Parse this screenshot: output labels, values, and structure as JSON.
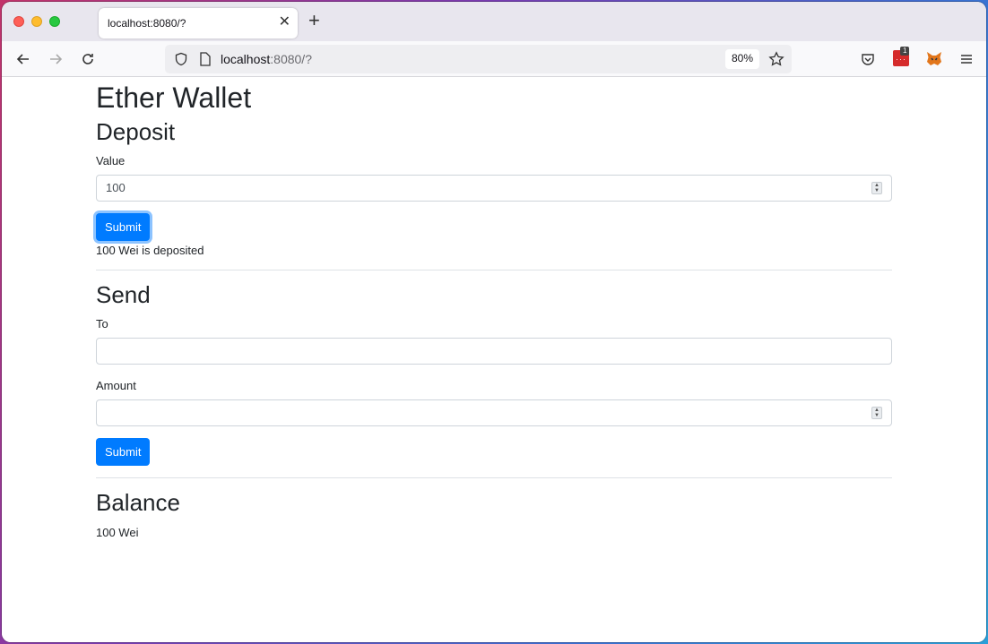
{
  "browser": {
    "tab_title": "localhost:8080/?",
    "url_host": "localhost",
    "url_port": ":8080/?",
    "zoom": "80%",
    "extension_badge": "1"
  },
  "page": {
    "title": "Ether Wallet",
    "deposit": {
      "heading": "Deposit",
      "value_label": "Value",
      "value": "100",
      "submit_label": "Submit",
      "status": "100 Wei is deposited"
    },
    "send": {
      "heading": "Send",
      "to_label": "To",
      "to_value": "",
      "amount_label": "Amount",
      "amount_value": "",
      "submit_label": "Submit"
    },
    "balance": {
      "heading": "Balance",
      "value": "100 Wei"
    }
  },
  "colors": {
    "primary": "#007bff",
    "text": "#212529"
  }
}
